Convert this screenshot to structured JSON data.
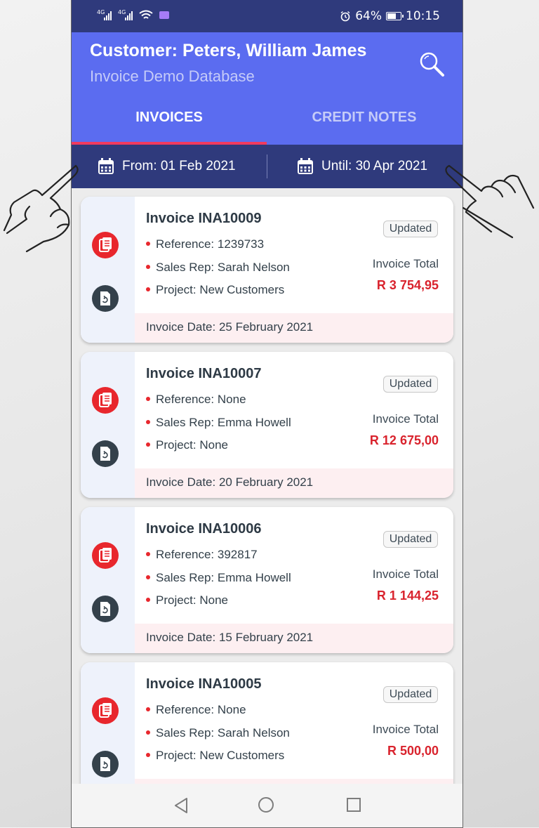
{
  "status_bar": {
    "signal_1": "4G",
    "signal_2": "4G",
    "alarm_icon": "alarm-clock-icon",
    "battery": "64%",
    "time": "10:15"
  },
  "header": {
    "title": "Customer: Peters, William James",
    "subtitle": "Invoice Demo Database",
    "search_icon": "search-icon"
  },
  "tabs": [
    {
      "label": "INVOICES",
      "active": true
    },
    {
      "label": "CREDIT NOTES",
      "active": false
    }
  ],
  "date_filter": {
    "from": "From: 01 Feb 2021",
    "until": "Until: 30 Apr 2021",
    "icon": "calendar-icon"
  },
  "invoices": [
    {
      "title": "Invoice INA10009",
      "reference": "Reference: 1239733",
      "sales_rep": "Sales Rep: Sarah Nelson",
      "project": "Project: New Customers",
      "badge": "Updated",
      "total_label": "Invoice Total",
      "total": "R 3 754,95",
      "date": "Invoice Date: 25 February 2021"
    },
    {
      "title": "Invoice INA10007",
      "reference": "Reference: None",
      "sales_rep": "Sales Rep: Emma Howell",
      "project": "Project: None",
      "badge": "Updated",
      "total_label": "Invoice Total",
      "total": "R 12 675,00",
      "date": "Invoice Date: 20 February 2021"
    },
    {
      "title": "Invoice INA10006",
      "reference": "Reference: 392817",
      "sales_rep": "Sales Rep: Emma Howell",
      "project": "Project: None",
      "badge": "Updated",
      "total_label": "Invoice Total",
      "total": "R 1 144,25",
      "date": "Invoice Date: 15 February 2021"
    },
    {
      "title": "Invoice INA10005",
      "reference": "Reference: None",
      "sales_rep": "Sales Rep: Sarah Nelson",
      "project": "Project: New Customers",
      "badge": "Updated",
      "total_label": "Invoice Total",
      "total": "R 500,00",
      "date": ""
    }
  ],
  "nav_bar": {
    "back_icon": "back-triangle-icon",
    "home_icon": "home-circle-icon",
    "recents_icon": "recents-square-icon"
  },
  "colors": {
    "app_bar": "#5b6cf0",
    "status_bar": "#2f3a7c",
    "accent": "#f03a5f",
    "total_red": "#d9232d"
  }
}
